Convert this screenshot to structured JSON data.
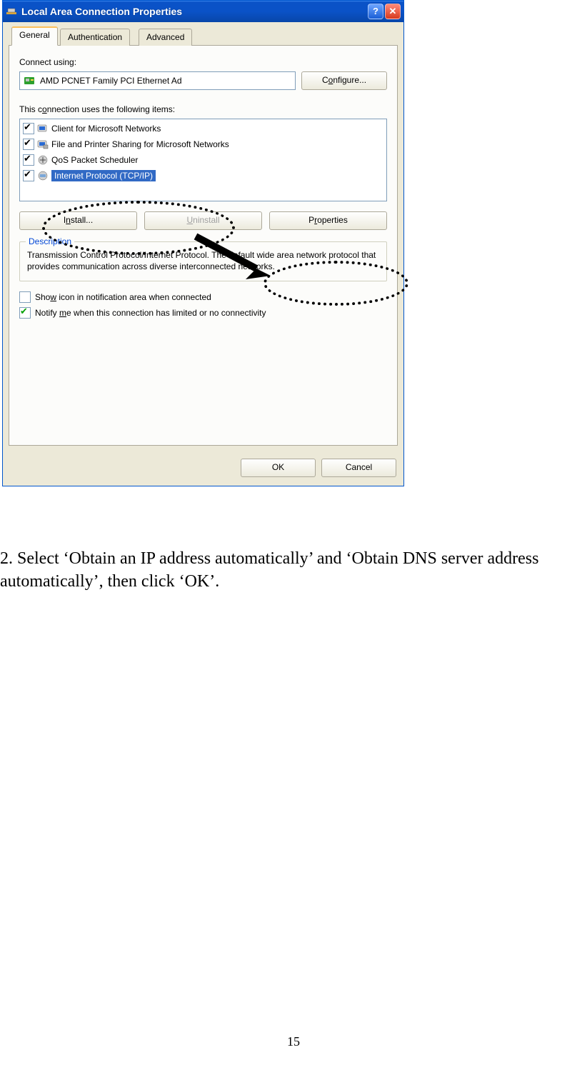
{
  "dialog": {
    "title": "Local Area Connection Properties",
    "help_glyph": "?",
    "close_glyph": "✕",
    "tabs": [
      {
        "label": "General"
      },
      {
        "label": "Authentication"
      },
      {
        "label": "Advanced"
      }
    ],
    "connect_using_label": "Connect using:",
    "adapter_name": "AMD PCNET Family PCI Ethernet Ad",
    "configure_btn": "Configure...",
    "items_label": "This connection uses the following items:",
    "items": [
      {
        "label": "Client for Microsoft Networks",
        "checked": true,
        "selected": false
      },
      {
        "label": "File and Printer Sharing for Microsoft Networks",
        "checked": true,
        "selected": false
      },
      {
        "label": "QoS Packet Scheduler",
        "checked": true,
        "selected": false
      },
      {
        "label": "Internet Protocol (TCP/IP)",
        "checked": true,
        "selected": true
      }
    ],
    "install_btn": "Install...",
    "uninstall_btn": "Uninstall",
    "properties_btn": "Properties",
    "description_legend": "Description",
    "description_text": "Transmission Control Protocol/Internet Protocol. The default wide area network protocol that provides communication across diverse interconnected networks.",
    "show_icon_label": "Show icon in notification area when connected",
    "show_icon_checked": false,
    "notify_label": "Notify me when this connection has limited or no connectivity",
    "notify_checked": true,
    "ok_btn": "OK",
    "cancel_btn": "Cancel"
  },
  "instruction_text": "2. Select ‘Obtain an IP address automatically’ and ‘Obtain DNS server address automatically’, then click ‘OK’.",
  "page_number": "15"
}
